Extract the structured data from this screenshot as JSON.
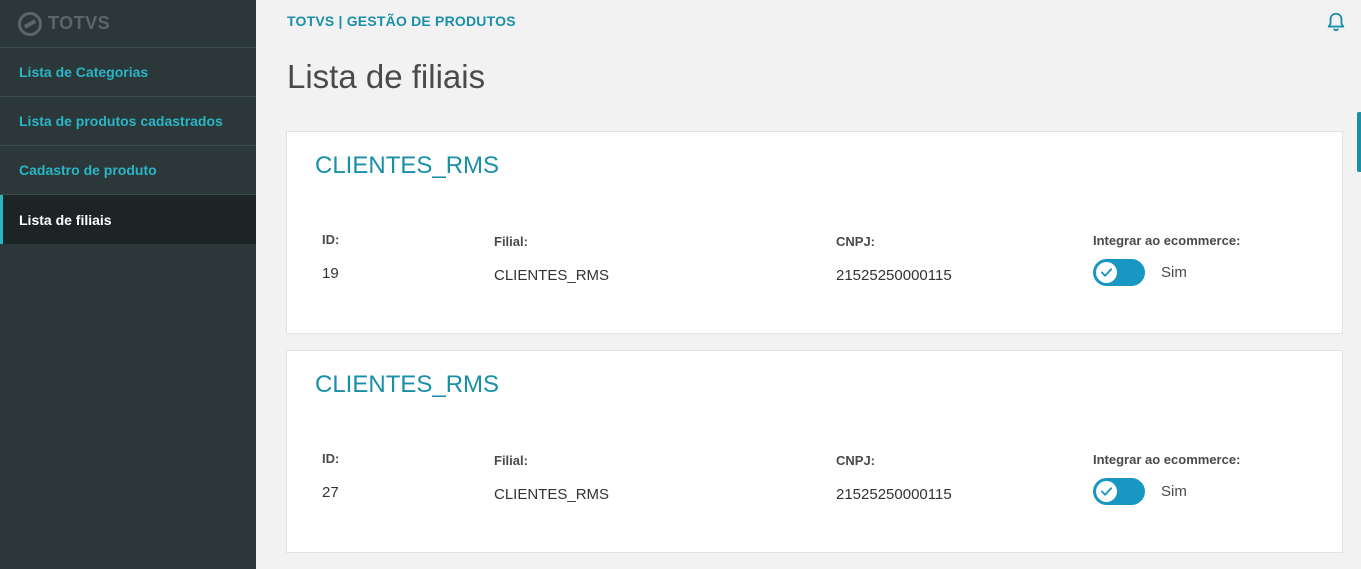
{
  "sidebar": {
    "logo_text": "TOTVS",
    "items": [
      {
        "label": "Lista de Categorias"
      },
      {
        "label": "Lista de produtos cadastrados"
      },
      {
        "label": "Cadastro de produto"
      },
      {
        "label": "Lista de filiais",
        "active": true
      }
    ]
  },
  "header": {
    "app_title": "TOTVS | GESTÃO DE PRODUTOS",
    "bell_icon": "notification-bell-icon"
  },
  "page": {
    "title": "Lista de filiais"
  },
  "labels": {
    "id": "ID:",
    "filial": "Filial:",
    "cnpj": "CNPJ:",
    "integrar": "Integrar ao ecommerce:"
  },
  "branches": [
    {
      "name": "CLIENTES_RMS",
      "id": "19",
      "filial": "CLIENTES_RMS",
      "cnpj": "21525250000115",
      "integrar": true,
      "integrar_label": "Sim"
    },
    {
      "name": "CLIENTES_RMS",
      "id": "27",
      "filial": "CLIENTES_RMS",
      "cnpj": "21525250000115",
      "integrar": true,
      "integrar_label": "Sim"
    }
  ],
  "colors": {
    "accent": "#1a8fa8",
    "sidebar_bg": "#2c3739",
    "toggle_on": "#1797c1"
  }
}
